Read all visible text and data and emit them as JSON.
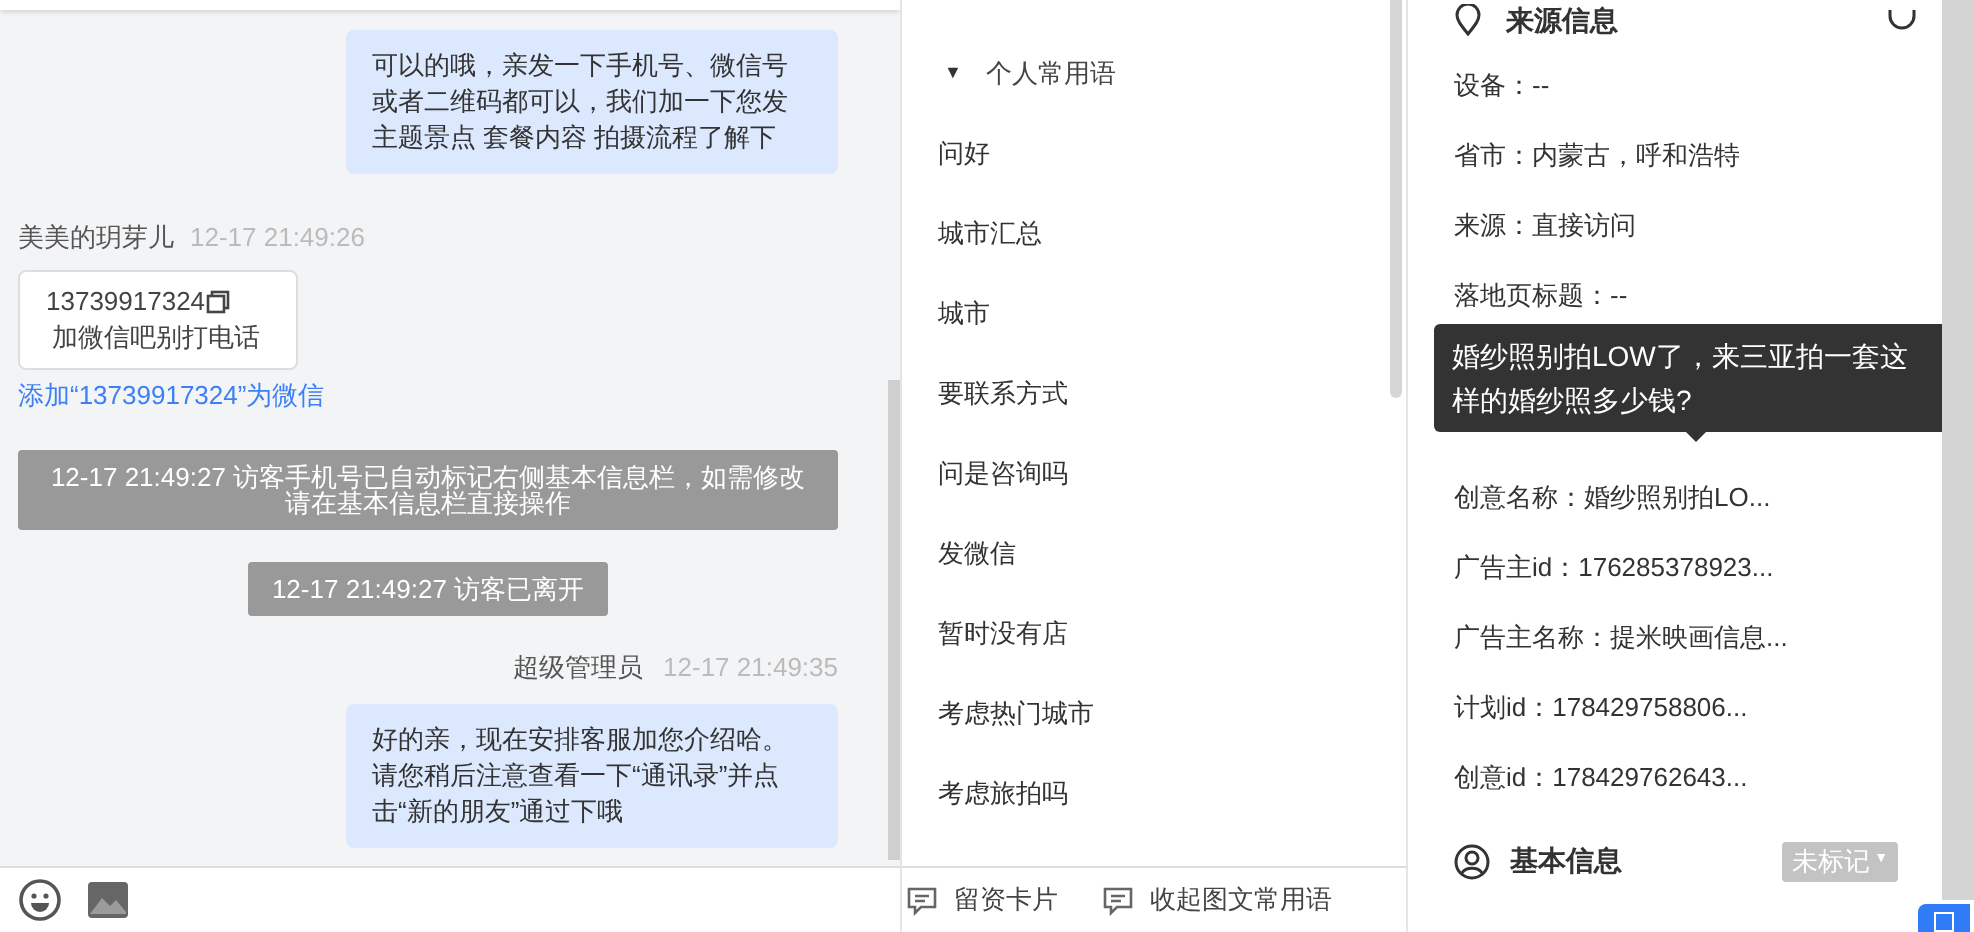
{
  "chat": {
    "messages": [
      {
        "kind": "agent",
        "text": "可以的哦，亲发一下手机号、微信号或者二维码都可以，我们加一下您发主题景点 套餐内容 拍摄流程了解下"
      },
      {
        "kind": "visitor",
        "sender": "美美的玥芽儿",
        "time": "12-17 21:49:26",
        "card_number": "13739917324",
        "card_note": "加微信吧别打电话",
        "link": "添加“13739917324”为微信"
      },
      {
        "kind": "system",
        "text": "12-17 21:49:27 访客手机号已自动标记右侧基本信息栏，如需修改请在基本信息栏直接操作"
      },
      {
        "kind": "system",
        "text": "12-17 21:49:27 访客已离开"
      },
      {
        "kind": "agent",
        "sender": "超级管理员",
        "time": "12-17 21:49:35",
        "text": "好的亲，现在安排客服加您介绍哈。请您稍后注意查看一下“通讯录”并点击“新的朋友”通过下哦"
      }
    ]
  },
  "phrases": {
    "group": {
      "label": "个人常用语",
      "expanded": true,
      "caret": "▼"
    },
    "items": [
      "问好",
      "城市汇总",
      "城市",
      "要联系方式",
      "问是咨询吗",
      "发微信",
      "暂时没有店",
      "考虑热门城市",
      "考虑旅拍吗"
    ],
    "footer_buttons": [
      "留资卡片",
      "收起图文常用语"
    ]
  },
  "source_info": {
    "title": "来源信息",
    "fields": [
      {
        "kind": "field",
        "text": "设备：--"
      },
      {
        "kind": "field",
        "text": "省市：内蒙古，呼和浩特"
      },
      {
        "kind": "field",
        "text": "来源：直接访问"
      },
      {
        "kind": "field",
        "text": "落地页标题：--"
      },
      {
        "kind": "tooltip",
        "text": "婚纱照别拍LOW了，来三亚拍一套这样的婚纱照多少钱?"
      },
      {
        "kind": "field",
        "text": "创意名称：婚纱照别拍LO..."
      },
      {
        "kind": "field",
        "text": "广告主id：176285378923..."
      },
      {
        "kind": "field",
        "text": "广告主名称：提米映画信息..."
      },
      {
        "kind": "field",
        "text": "计划id：178429758806..."
      },
      {
        "kind": "field",
        "text": "创意id：178429762643..."
      }
    ]
  },
  "basic_info": {
    "title": "基本信息",
    "tag": "未标记",
    "caret": "▼"
  }
}
